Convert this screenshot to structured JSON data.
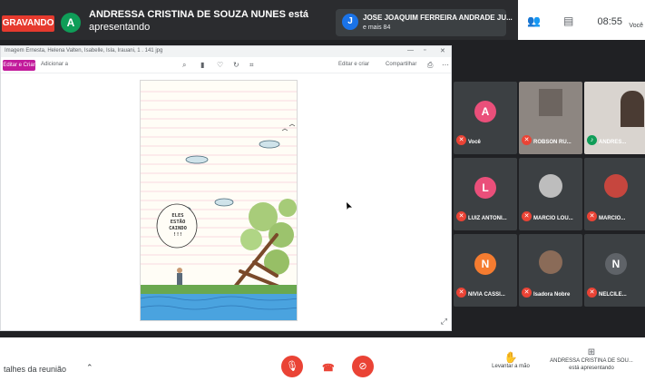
{
  "top_bar": {
    "recording_label": "GRAVANDO",
    "presenter_avatar": "A",
    "presenter_name": "ANDRESSA CRISTINA DE SOUZA NUNES está",
    "presenter_status": "apresentando",
    "pinned_avatar": "J",
    "pinned_name": "JOSE JOAQUIM FERREIRA ANDRADE JU...",
    "pinned_more": "e mais 84",
    "time": "08:55",
    "user_short": "Você"
  },
  "presentation": {
    "doc_title": "Imagem Ernesta, Helena Valten, Isabelle, Isla, Irauani, 1 . 141 jpg",
    "window_controls": [
      "—",
      "▫",
      "✕"
    ],
    "toolbar": {
      "edit_button": "Editar e Criar",
      "add_link": "Adicionar a",
      "draw_link": "Editar e criar",
      "share_link": "Compartilhar"
    },
    "drawing_speech": [
      "ELES",
      "ESTÃO",
      "CAINDO",
      "!!!"
    ]
  },
  "participants": [
    {
      "initial": "A",
      "name": "Você",
      "color": "#ea4f7a",
      "type": "avatar"
    },
    {
      "name": "ROBSON RU...",
      "type": "video"
    },
    {
      "name": "ANDRES...",
      "type": "video"
    },
    {
      "initial": "L",
      "name": "LUIZ ANTONI...",
      "color": "#ea4f7a",
      "type": "avatar"
    },
    {
      "name": "MARCIO LOU...",
      "type": "photo"
    },
    {
      "name": "MARCIO...",
      "type": "photo"
    },
    {
      "initial": "N",
      "name": "NIVIA CASSI...",
      "color": "#f57c30",
      "type": "avatar"
    },
    {
      "name": "Isadora Nobre",
      "type": "photo"
    },
    {
      "initial": "N",
      "name": "NELCILE...",
      "color": "#5f6368",
      "type": "avatar"
    }
  ],
  "bottom_bar": {
    "details_label": "talhes da reunião",
    "raise_hand_label": "Levantar a mão",
    "presenting_label_line1": "ANDRESSA CRISTINA DE SOU...",
    "presenting_label_line2": "está apresentando"
  },
  "colors": {
    "accent_red": "#ea4335",
    "recording_red": "#e63a2e",
    "presenter_green": "#0f9d58",
    "pinned_blue": "#1a73e8"
  }
}
